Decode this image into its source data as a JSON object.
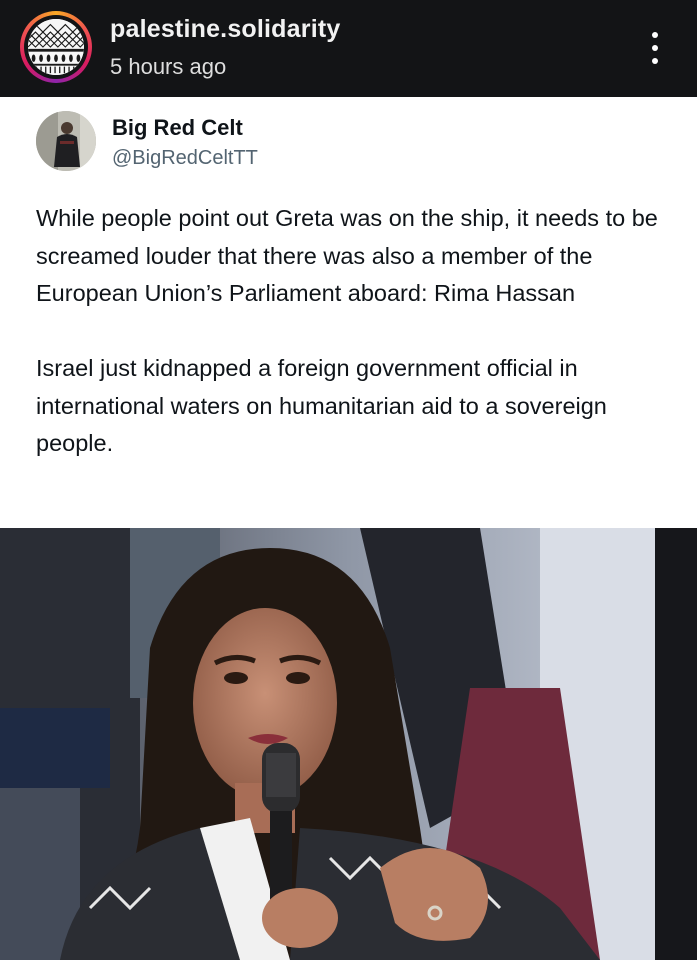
{
  "header": {
    "account_name": "palestine.solidarity",
    "post_time": "5 hours ago",
    "avatar_icon": "keffiyeh-pattern-avatar",
    "more_icon": "more-vertical-icon",
    "ring_colors": [
      "#f9a825",
      "#ef5350",
      "#d81b60",
      "#8e24aa"
    ]
  },
  "tweet": {
    "display_name": "Big Red Celt",
    "handle": "@BigRedCeltTT",
    "avatar_icon": "profile-photo-avatar",
    "paragraphs": [
      "While people point out Greta was on the ship, it needs to be screamed louder that there was also a member of the European Union’s Parliament aboard: Rima Hassan",
      "Israel just kidnapped a foreign government official in international waters on humanitarian aid to a sovereign people."
    ]
  },
  "photo": {
    "subject": "woman-speaking-into-microphone-photo",
    "colors": {
      "background": "#2a2c33",
      "accent": "#6e2a3c"
    }
  }
}
